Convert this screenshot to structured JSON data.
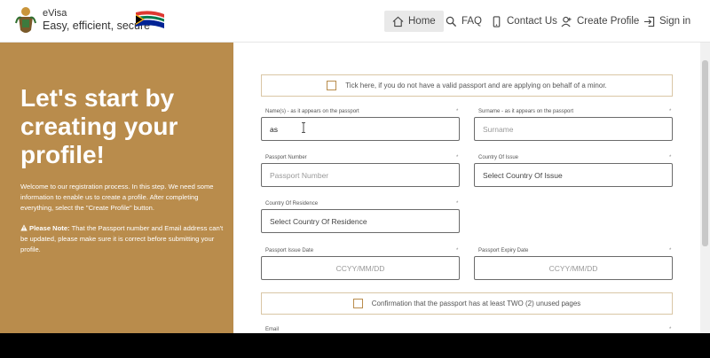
{
  "brand": {
    "title": "eVisa",
    "tagline": "Easy, efficient, secure"
  },
  "nav": {
    "home": "Home",
    "faq": "FAQ",
    "contact": "Contact Us",
    "create_profile": "Create Profile",
    "sign_in": "Sign in"
  },
  "left": {
    "heading": "Let's start by creating your profile!",
    "welcome": "Welcome to our registration process. In this step. We need some information to enable us to create a profile. After completing everything, select the \"Create Profile\" button.",
    "note_label": "Please Note:",
    "note_text": " That the Passport number and Email address can't be updated, please make sure it is correct before submitting your profile."
  },
  "form": {
    "minor_checkbox": "Tick here, if you do not have a valid passport and are applying on behalf of a minor.",
    "names": {
      "label": "Name(s) - as it appears on the passport",
      "value": "as"
    },
    "surname": {
      "label": "Surname - as it appears on the passport",
      "placeholder": "Surname"
    },
    "passport_number": {
      "label": "Passport Number",
      "placeholder": "Passport Number"
    },
    "country_issue": {
      "label": "Country Of Issue",
      "selected": "Select Country Of Issue"
    },
    "country_residence": {
      "label": "Country Of Residence",
      "selected": "Select Country Of Residence"
    },
    "issue_date": {
      "label": "Passport Issue Date",
      "placeholder": "CCYY/MM/DD"
    },
    "expiry_date": {
      "label": "Passport Expiry Date",
      "placeholder": "CCYY/MM/DD"
    },
    "pages_checkbox": "Confirmation that the passport has at least TWO (2) unused pages",
    "email": {
      "label": "Email"
    },
    "required_mark": "*"
  },
  "colors": {
    "panel": "#b98c4c",
    "border": "#6b6b6b"
  }
}
